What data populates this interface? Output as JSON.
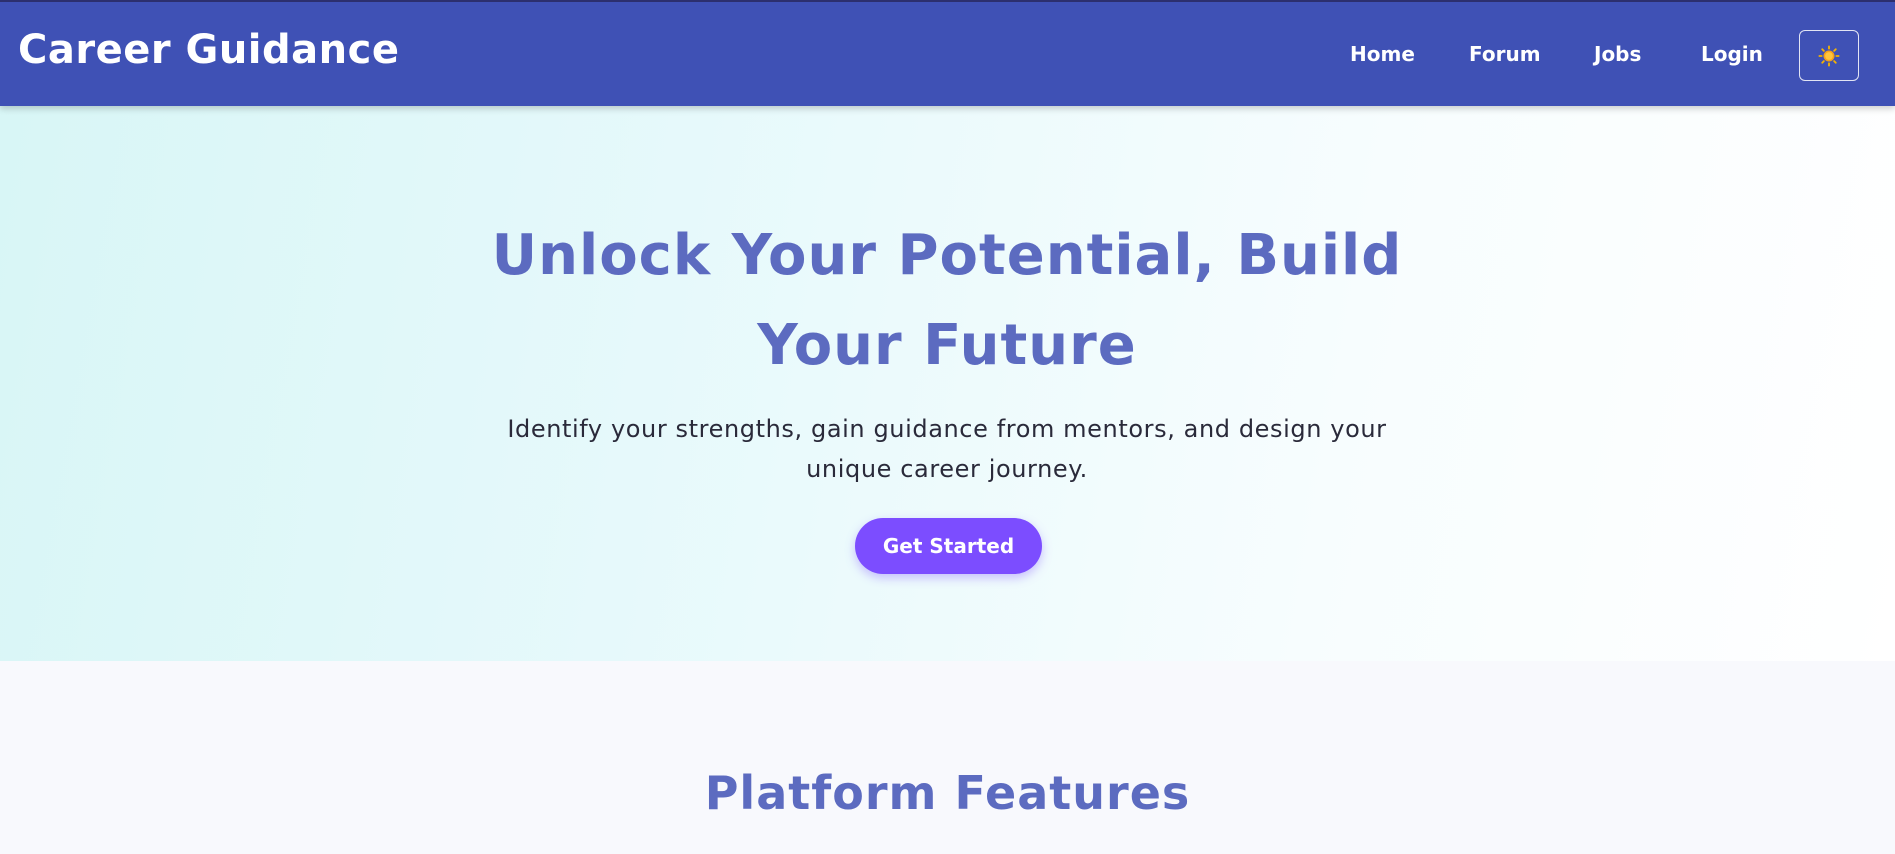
{
  "navbar": {
    "brand": "Career Guidance",
    "links": [
      {
        "label": "Home"
      },
      {
        "label": "Forum"
      },
      {
        "label": "Jobs"
      },
      {
        "label": "Login"
      }
    ],
    "theme_toggle_icon": "sun-icon"
  },
  "hero": {
    "title": "Unlock Your Potential, Build Your Future",
    "subtitle": "Identify your strengths, gain guidance from mentors, and design your unique career journey.",
    "cta_label": "Get Started"
  },
  "features": {
    "title": "Platform Features"
  },
  "colors": {
    "navbar_bg": "#3f51b5",
    "heading": "#5c6bc0",
    "cta_bg": "#7c4dff",
    "sun": "#f5b300"
  }
}
